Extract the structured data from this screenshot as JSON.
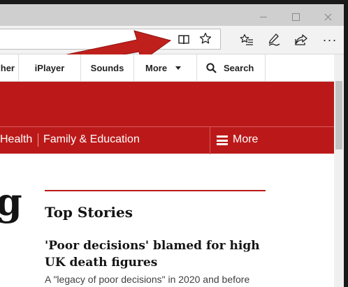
{
  "browser": {
    "window_controls": {
      "minimize": "minimize",
      "maximize": "maximize",
      "close": "close"
    },
    "toolbar": {
      "more_label": "···"
    }
  },
  "bbc_nav": {
    "items": [
      {
        "label": "her"
      },
      {
        "label": "iPlayer"
      },
      {
        "label": "Sounds"
      },
      {
        "label": "More"
      },
      {
        "label": "Search"
      }
    ]
  },
  "section_nav": {
    "items": [
      {
        "label": "Health"
      },
      {
        "label": "Family & Education"
      }
    ],
    "more_label": "More"
  },
  "content": {
    "partial_heading": "g",
    "section_title": "Top Stories",
    "headline": "'Poor decisions' blamed for high UK death figures",
    "summary": "A \"legacy of poor decisions\" in 2020 and before"
  },
  "colors": {
    "bbc_red": "#bb1919",
    "annotation_arrow": "#c0201c",
    "toolbar_bg": "#f2f2f2",
    "titlebar_bg": "#cfcfcf"
  },
  "icons": [
    "reading-view-icon",
    "favorite-star-icon",
    "favorites-hub-icon",
    "pen-notes-icon",
    "share-icon",
    "more-icon",
    "search-icon",
    "hamburger-icon",
    "caret-down-icon",
    "annotation-arrow"
  ]
}
